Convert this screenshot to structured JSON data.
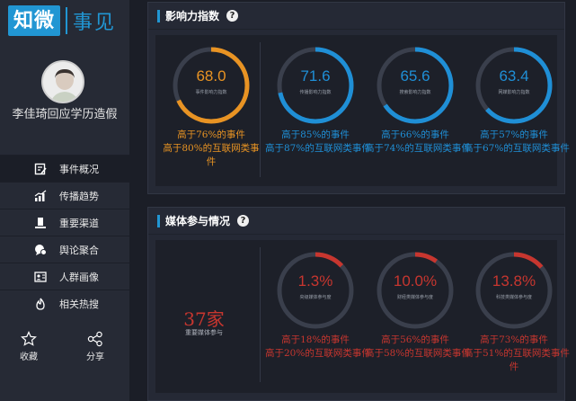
{
  "logo": {
    "box_text": "知微",
    "text": "事见"
  },
  "profile": {
    "name": "李佳琦回应学历造假"
  },
  "menu": [
    {
      "label": "事件概况",
      "icon": "report-icon",
      "active": true
    },
    {
      "label": "传播趋势",
      "icon": "trend-chart-icon"
    },
    {
      "label": "重要渠道",
      "icon": "podium-icon"
    },
    {
      "label": "舆论聚合",
      "icon": "speech-bubble-icon"
    },
    {
      "label": "人群画像",
      "icon": "id-card-icon"
    },
    {
      "label": "相关热搜",
      "icon": "flame-icon"
    }
  ],
  "actions": {
    "collect": "收藏",
    "share": "分享"
  },
  "influence": {
    "title": "影响力指数",
    "help": "?",
    "items": [
      {
        "value": "68.0",
        "caption": "事件影响力指数",
        "fraction": 0.68,
        "color": "#e89323",
        "line1": "高于76%的事件",
        "line2": "高于80%的互联网类事",
        "line3": "件"
      },
      {
        "value": "71.6",
        "caption": "传播影响力指数",
        "fraction": 0.716,
        "color": "#1f8fd6",
        "line1": "高于85%的事件",
        "line2": "高于87%的互联网类事件",
        "line3": ""
      },
      {
        "value": "65.6",
        "caption": "搜索影响力指数",
        "fraction": 0.656,
        "color": "#1f8fd6",
        "line1": "高于66%的事件",
        "line2": "高于74%的互联网类事件",
        "line3": ""
      },
      {
        "value": "63.4",
        "caption": "网媒影响力指数",
        "fraction": 0.634,
        "color": "#1f8fd6",
        "line1": "高于57%的事件",
        "line2": "高于67%的互联网类事件",
        "line3": ""
      }
    ]
  },
  "media": {
    "title": "媒体参与情况",
    "help": "?",
    "count": "37家",
    "count_caption": "重要媒体参与",
    "items": [
      {
        "value": "1.3%",
        "caption": "央级媒体参与度",
        "fraction": 0.13,
        "color": "#c7362f",
        "line1": "高于18%的事件",
        "line2": "高于20%的互联网类事件",
        "line3": ""
      },
      {
        "value": "10.0%",
        "caption": "财经类媒体参与度",
        "fraction": 0.1,
        "color": "#c7362f",
        "line1": "高于56%的事件",
        "line2": "高于58%的互联网类事件",
        "line3": ""
      },
      {
        "value": "13.8%",
        "caption": "科技类媒体参与度",
        "fraction": 0.138,
        "color": "#c7362f",
        "line1": "高于73%的事件",
        "line2": "高于51%的互联网类事件",
        "line3": "件"
      }
    ]
  }
}
